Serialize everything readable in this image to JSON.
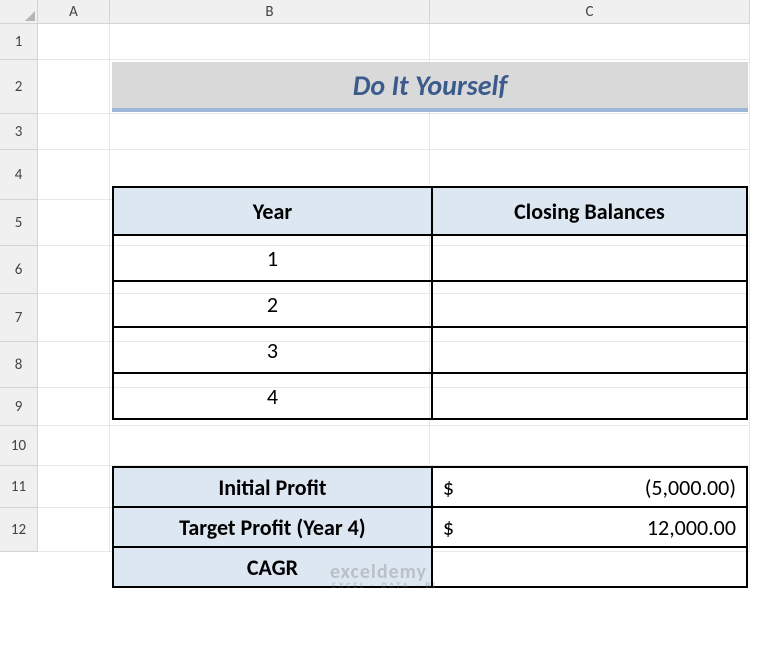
{
  "columns": [
    "A",
    "B",
    "C"
  ],
  "rows": [
    "1",
    "2",
    "3",
    "4",
    "5",
    "6",
    "7",
    "8",
    "9",
    "10",
    "11",
    "12"
  ],
  "title": "Do It Yourself",
  "table1": {
    "headers": {
      "year": "Year",
      "closing": "Closing Balances"
    },
    "rows": [
      {
        "year": "1",
        "closing": ""
      },
      {
        "year": "2",
        "closing": ""
      },
      {
        "year": "3",
        "closing": ""
      },
      {
        "year": "4",
        "closing": ""
      }
    ]
  },
  "summary": {
    "rows": [
      {
        "label": "Initial Profit",
        "currency": "$",
        "value": "(5,000.00)"
      },
      {
        "label": "Target Profit (Year 4)",
        "currency": "$",
        "value": "12,000.00"
      },
      {
        "label": "CAGR",
        "currency": "",
        "value": ""
      }
    ]
  },
  "watermark": {
    "main": "exceldemy",
    "sub": "EXCEL · DATA · BI"
  }
}
